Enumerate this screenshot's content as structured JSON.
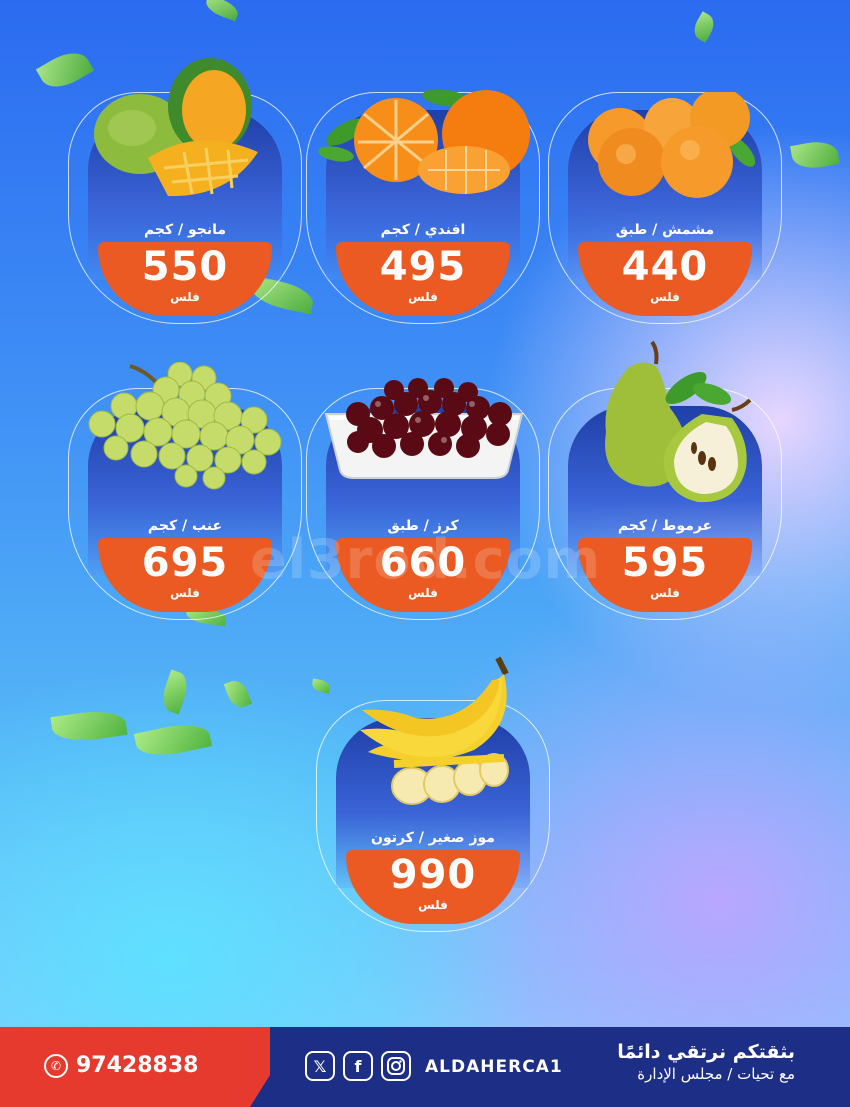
{
  "watermark": "el3rod.com",
  "products": [
    {
      "name": "مشمش / طبق",
      "price": "440",
      "unit": "فلس",
      "fruit": "apricot-icon"
    },
    {
      "name": "افندي / كجم",
      "price": "495",
      "unit": "فلس",
      "fruit": "mandarin-icon"
    },
    {
      "name": "مانجو / كجم",
      "price": "550",
      "unit": "فلس",
      "fruit": "mango-icon"
    },
    {
      "name": "عرموط / كجم",
      "price": "595",
      "unit": "فلس",
      "fruit": "pear-icon"
    },
    {
      "name": "كرز / طبق",
      "price": "660",
      "unit": "فلس",
      "fruit": "cherry-icon"
    },
    {
      "name": "عنب / كجم",
      "price": "695",
      "unit": "فلس",
      "fruit": "grape-icon"
    },
    {
      "name": "موز صغير / كرتون",
      "price": "990",
      "unit": "فلس",
      "fruit": "banana-icon"
    }
  ],
  "footer": {
    "slogan_line1": "بثقتكم نرتقي دائمًا",
    "slogan_line2": "مع تحيات / مجلس الإدارة",
    "handle": "ALDAHERCA1",
    "phone": "97428838",
    "social_icons": [
      "instagram-icon",
      "facebook-icon",
      "x-icon"
    ],
    "whatsapp_icon": "whatsapp-icon"
  },
  "colors": {
    "price_band": "#ea5a22",
    "footer_blue": "#1d2e86",
    "footer_red": "#e63a2e"
  }
}
